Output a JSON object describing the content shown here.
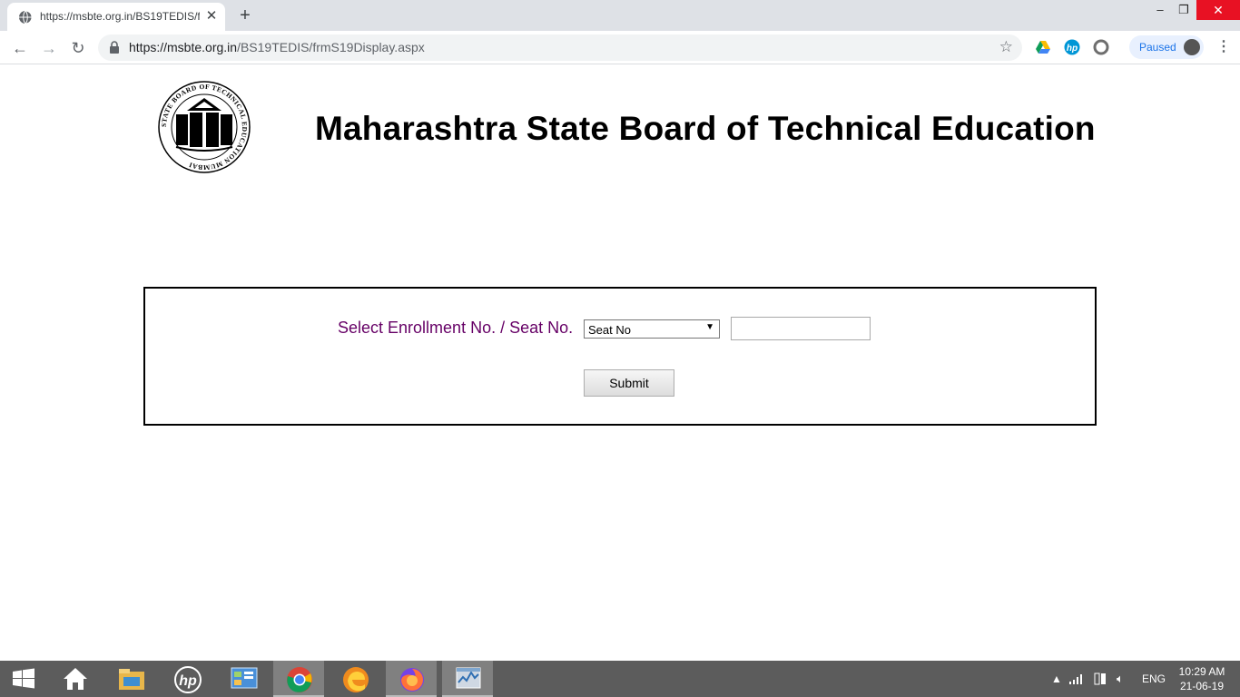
{
  "browser": {
    "tab_title": "https://msbte.org.in/BS19TEDIS/f",
    "url_host": "https://msbte.org.in",
    "url_path": "/BS19TEDIS/frmS19Display.aspx",
    "profile_status": "Paused",
    "icons": [
      "globe-icon",
      "close-icon",
      "plus-icon",
      "back-icon",
      "forward-icon",
      "reload-icon",
      "lock-icon",
      "star-icon",
      "google-drive-icon",
      "hp-icon",
      "extension-circle-icon",
      "menu-icon"
    ]
  },
  "page": {
    "heading": "Maharashtra State Board of Technical Education",
    "logo_text": "STATE BOARD OF TECHNICAL EDUCATION MUMBAI",
    "form": {
      "select_label": "Select Enrollment No. / Seat No.",
      "dropdown_value": "Seat No",
      "text_value": "",
      "submit_label": "Submit"
    },
    "colors": {
      "label": "#660066",
      "heading": "#000000"
    }
  },
  "taskbar": {
    "apps": [
      "windows-start-icon",
      "home-icon",
      "file-explorer-icon",
      "hp-icon",
      "control-panel-icon",
      "chrome-icon",
      "edge-icon",
      "firefox-icon",
      "task-manager-icon"
    ],
    "language": "ENG",
    "time": "10:29 AM",
    "date": "21-06-19"
  }
}
